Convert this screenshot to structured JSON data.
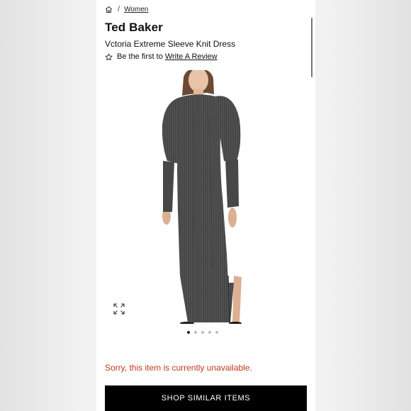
{
  "breadcrumb": {
    "home_icon": "home-icon",
    "separator": "/",
    "link": "Women"
  },
  "product": {
    "brand": "Ted Baker",
    "name": "Vctoria Extreme Sleeve Knit Dress",
    "review_prefix": "Be the first to",
    "review_link": "Write A Review",
    "review_icon": "star-outline-icon"
  },
  "gallery": {
    "image_alt": "Model wearing a grey long-sleeve knit midi dress with puffed shoulders",
    "expand_icon": "expand-icon",
    "total_images": 5,
    "active_index": 0
  },
  "availability": {
    "message": "Sorry, this item is currently unavailable.",
    "color": "#c0391b"
  },
  "actions": {
    "shop_similar": "SHOP SIMILAR ITEMS"
  }
}
